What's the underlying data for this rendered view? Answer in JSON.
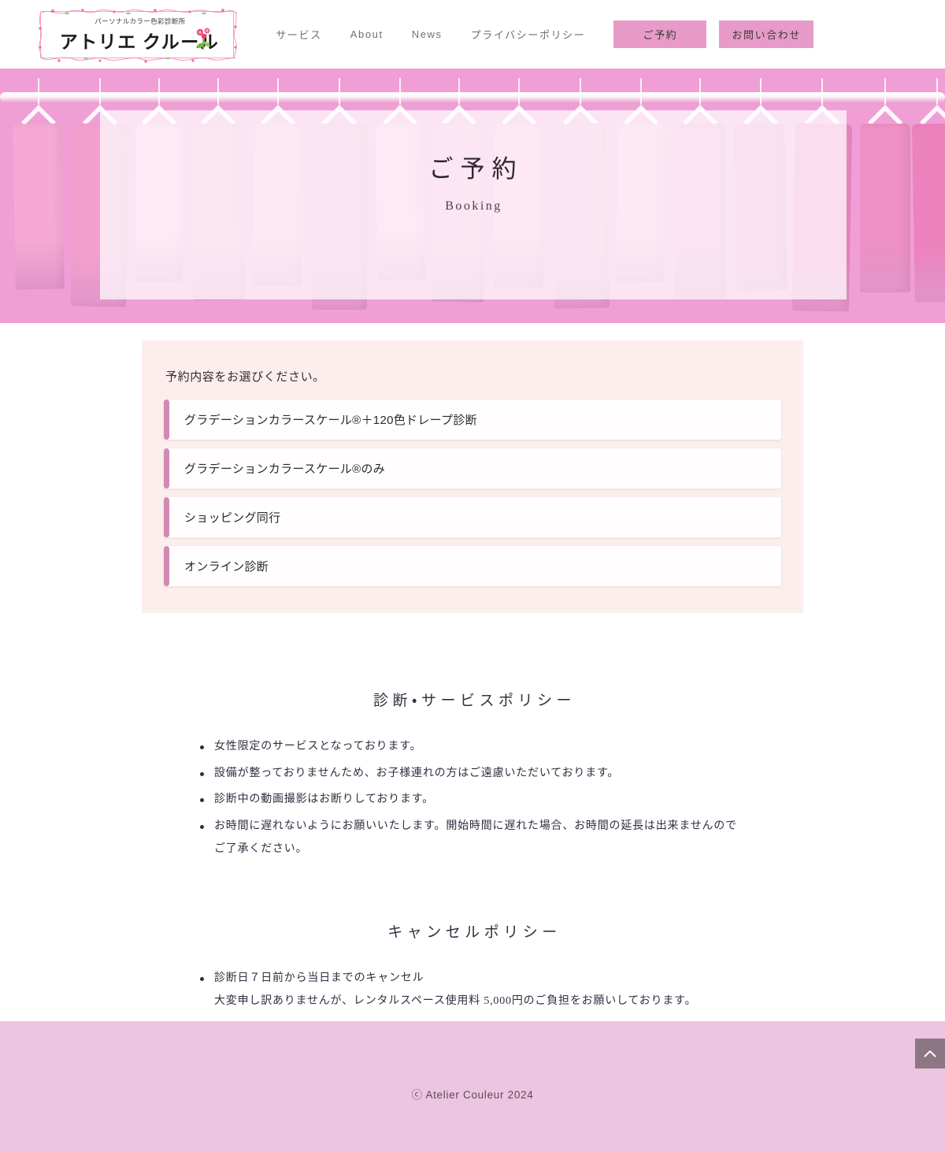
{
  "header": {
    "logo": {
      "sub_text": "パーソナルカラー色彩診断所",
      "main_text": "アトリエ クルール",
      "icon": "rose-flower-icon",
      "frame_icon": "rose-vine-frame-icon"
    },
    "nav_links": [
      {
        "label": "サービス"
      },
      {
        "label": "About"
      },
      {
        "label": "News"
      },
      {
        "label": "プライバシーポリシー"
      }
    ],
    "nav_buttons": [
      {
        "label": "ご予約"
      },
      {
        "label": "お問い合わせ"
      }
    ]
  },
  "hero": {
    "title": "ご予約",
    "subtitle": "Booking",
    "image_alt": "pink-clothes-rack-photo"
  },
  "booking": {
    "heading": "予約内容をお選びください。",
    "options": [
      {
        "label": "グラデーションカラースケール®＋120色ドレープ診断"
      },
      {
        "label": "グラデーションカラースケール®のみ"
      },
      {
        "label": "ショッピング同行"
      },
      {
        "label": "オンライン診断"
      }
    ]
  },
  "policies": [
    {
      "title": "診断・サービスポリシー",
      "items": [
        {
          "text": "女性限定のサービスとなっております。",
          "sub": ""
        },
        {
          "text": "設備が整っておりませんため、お子様連れの方はご遠慮いただいております。",
          "sub": ""
        },
        {
          "text": "診断中の動画撮影はお断りしております。",
          "sub": ""
        },
        {
          "text": "お時間に遅れないようにお願いいたします。開始時間に遅れた場合、お時間の延長は出来ませんのでご了承ください。",
          "sub": ""
        }
      ]
    },
    {
      "title": "キャンセルポリシー",
      "items": [
        {
          "text": "診断日７日前から当日までのキャンセル",
          "sub": "大変申し訳ありませんが、レンタルスペース使用料 5,000円のご負担をお願いしております。"
        }
      ]
    }
  ],
  "footer": {
    "copyright": "ⓒ Atelier Couleur 2024",
    "to_top_icon": "chevron-up-icon"
  },
  "colors": {
    "brand_pink": "#e89bc8",
    "hero_pink": "#ef9fd6",
    "panel_bg": "#fdeeee",
    "accent_bar": "#d08ab4",
    "footer_bg": "#ecc5e0",
    "to_top_bg": "#8d7785"
  }
}
